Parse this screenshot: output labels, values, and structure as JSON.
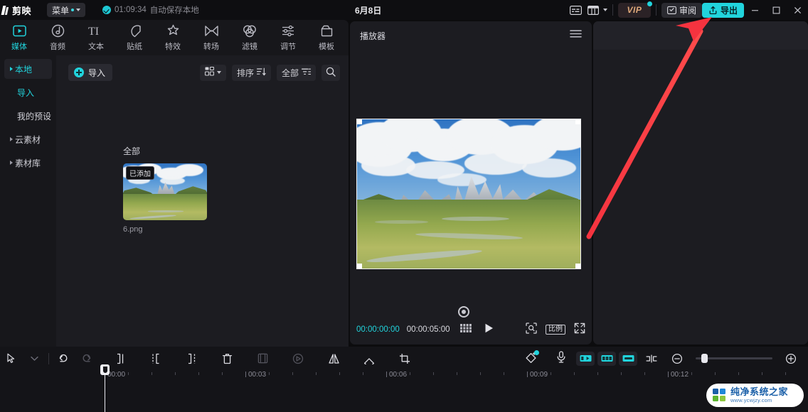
{
  "titlebar": {
    "app_name": "剪映",
    "menu_label": "菜单",
    "autosave_time": "01:09:34",
    "autosave_text": "自动保存本地",
    "project_date": "6月8日",
    "caption_icon": "caption-icon",
    "layout_icon": "layout-icon",
    "vip_label": "VIP",
    "review_label": "审阅",
    "export_label": "导出",
    "minimize": "—",
    "maximize": "□",
    "close": "✕",
    "accent": "#21d4dd"
  },
  "tabs": [
    {
      "label": "媒体",
      "icon": "media-icon",
      "active": true
    },
    {
      "label": "音频",
      "icon": "audio-icon",
      "active": false
    },
    {
      "label": "文本",
      "icon": "text-icon",
      "active": false
    },
    {
      "label": "贴纸",
      "icon": "sticker-icon",
      "active": false
    },
    {
      "label": "特效",
      "icon": "effects-icon",
      "active": false
    },
    {
      "label": "转场",
      "icon": "transition-icon",
      "active": false
    },
    {
      "label": "滤镜",
      "icon": "filter-icon",
      "active": false
    },
    {
      "label": "调节",
      "icon": "adjust-icon",
      "active": false
    },
    {
      "label": "模板",
      "icon": "template-icon",
      "active": false
    }
  ],
  "categories": [
    {
      "label": "本地",
      "selected": true,
      "expandable": true,
      "indent": 0
    },
    {
      "label": "导入",
      "selected": false,
      "expandable": false,
      "indent": 1,
      "highlight": true
    },
    {
      "label": "我的预设",
      "selected": false,
      "expandable": false,
      "indent": 1,
      "highlight": false
    },
    {
      "label": "云素材",
      "selected": false,
      "expandable": true,
      "indent": 0
    },
    {
      "label": "素材库",
      "selected": false,
      "expandable": true,
      "indent": 0
    }
  ],
  "media_panel": {
    "import_label": "导入",
    "grid_icon": "grid-view-icon",
    "sort_label": "排序",
    "sort_icon": "sort-icon",
    "filter_label": "全部",
    "filter_icon": "filter-icon",
    "search_icon": "search-icon",
    "section_label": "全部",
    "items": [
      {
        "name": "6.png",
        "badge": "已添加"
      }
    ]
  },
  "player": {
    "title": "播放器",
    "menu_icon": "hamburger-icon",
    "current_time": "00:00:00:00",
    "total_time": "00:00:05:00",
    "frames_icon": "frames-icon",
    "play_icon": "play-icon",
    "focus_icon": "focus-icon",
    "ratio_label": "比例",
    "fullscreen_icon": "fullscreen-icon",
    "reset_icon": "reset-position-icon"
  },
  "timeline": {
    "tools": [
      {
        "icon": "cursor-icon",
        "dim": false
      },
      {
        "icon": "chevron-down-icon",
        "dim": true
      },
      {
        "icon": "undo-icon",
        "dim": false
      },
      {
        "icon": "redo-icon",
        "dim": true
      },
      {
        "icon": "split-left-icon",
        "dim": false
      },
      {
        "icon": "trim-start-icon",
        "dim": false
      },
      {
        "icon": "trim-end-icon",
        "dim": false
      },
      {
        "icon": "delete-icon",
        "dim": false
      },
      {
        "icon": "crop-frame-icon",
        "dim": true
      },
      {
        "icon": "speed-icon",
        "dim": true
      },
      {
        "icon": "mirror-icon",
        "dim": false
      },
      {
        "icon": "rotate-icon",
        "dim": false
      },
      {
        "icon": "crop-icon",
        "dim": false
      }
    ],
    "right_tools": [
      {
        "icon": "auto-caption-icon",
        "dim": false
      },
      {
        "icon": "microphone-icon",
        "dim": false
      },
      {
        "icon": "keyframe-in-icon",
        "cyan": true
      },
      {
        "icon": "keyframe-mid-icon",
        "cyan": true
      },
      {
        "icon": "keyframe-out-icon",
        "cyan": true
      },
      {
        "icon": "snap-icon",
        "dim": false
      },
      {
        "icon": "zoom-out-icon",
        "dim": false
      },
      {
        "icon": "zoom-in-icon",
        "dim": false
      }
    ],
    "ruler_labels": [
      "00:00",
      "00:03",
      "00:06",
      "00:09",
      "00:12"
    ],
    "playhead_time": "00:00"
  },
  "watermark": {
    "name": "纯净系统之家",
    "url": "www.ycwjzy.com",
    "color_blue": "#1a5fa8",
    "color_green": "#5cb531"
  },
  "annotation": {
    "arrow_color": "#f5333f",
    "points_to": "导出"
  }
}
